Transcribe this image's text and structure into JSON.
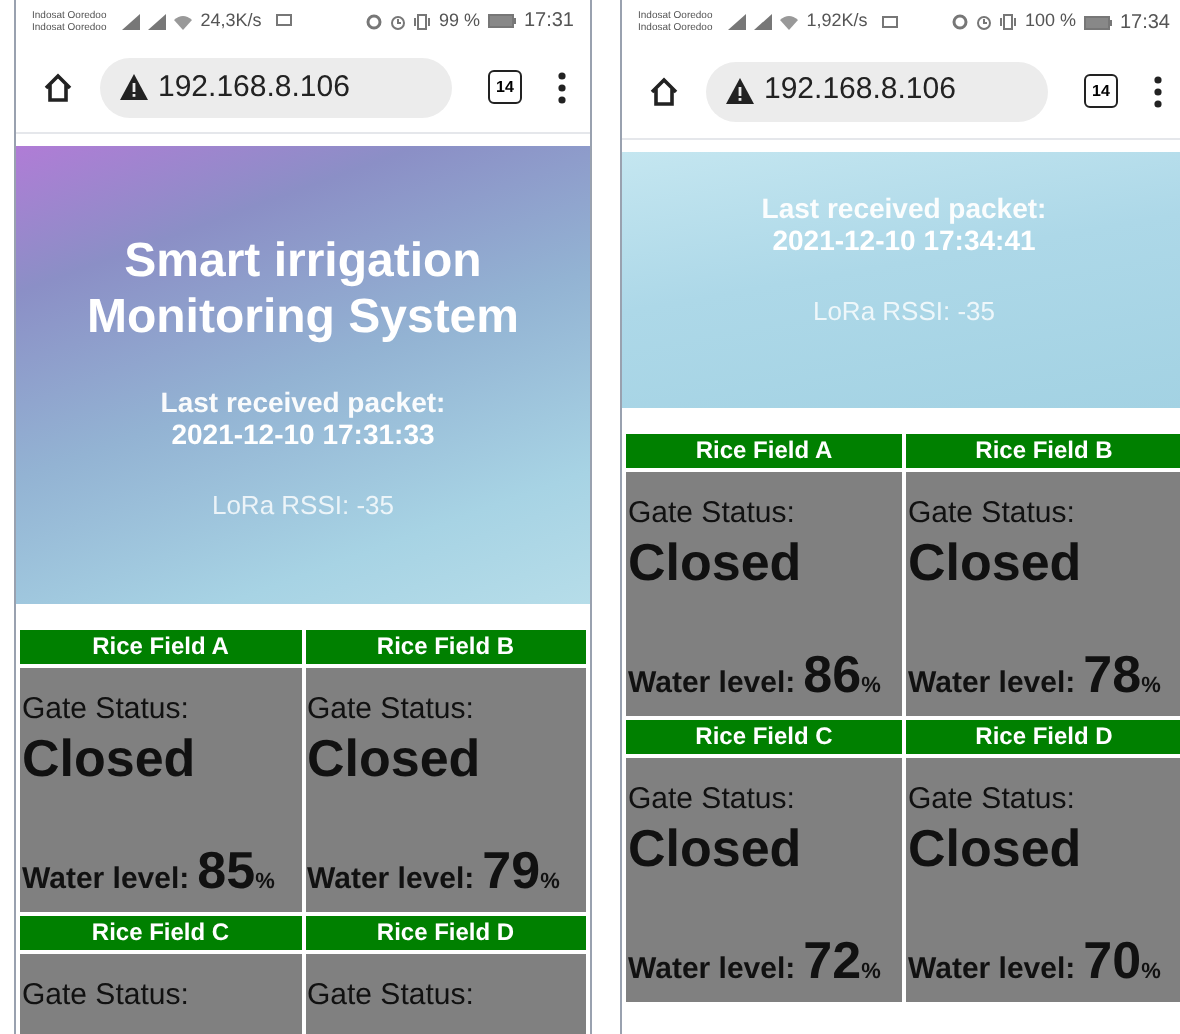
{
  "screens": [
    {
      "status_bar": {
        "carriers": [
          "Indosat Ooredoo",
          "Indosat Ooredoo"
        ],
        "speed": "24,3K/s",
        "battery": "99 %",
        "time": "17:31"
      },
      "browser": {
        "url": "192.168.8.106",
        "tab_count": "14"
      },
      "page": {
        "title": "Smart irrigation Monitoring System",
        "packet_label": "Last received packet:",
        "packet_time": "2021-12-10 17:31:33",
        "rssi": "LoRa RSSI: -35",
        "fields": [
          {
            "name": "Rice Field A",
            "gate_label": "Gate Status:",
            "gate_status": "Closed",
            "water_label": "Water level:",
            "water_value": "85",
            "unit": "%"
          },
          {
            "name": "Rice Field B",
            "gate_label": "Gate Status:",
            "gate_status": "Closed",
            "water_label": "Water level:",
            "water_value": "79",
            "unit": "%"
          },
          {
            "name": "Rice Field C",
            "gate_label": "Gate Status:"
          },
          {
            "name": "Rice Field D",
            "gate_label": "Gate Status:"
          }
        ]
      }
    },
    {
      "status_bar": {
        "carriers": [
          "Indosat Ooredoo",
          "Indosat Ooredoo"
        ],
        "speed": "1,92K/s",
        "battery": "100 %",
        "time": "17:34"
      },
      "browser": {
        "url": "192.168.8.106",
        "tab_count": "14"
      },
      "page": {
        "packet_label": "Last received packet:",
        "packet_time": "2021-12-10 17:34:41",
        "rssi": "LoRa RSSI: -35",
        "fields": [
          {
            "name": "Rice Field A",
            "gate_label": "Gate Status:",
            "gate_status": "Closed",
            "water_label": "Water level:",
            "water_value": "86",
            "unit": "%"
          },
          {
            "name": "Rice Field B",
            "gate_label": "Gate Status:",
            "gate_status": "Closed",
            "water_label": "Water level:",
            "water_value": "78",
            "unit": "%"
          },
          {
            "name": "Rice Field C",
            "gate_label": "Gate Status:",
            "gate_status": "Closed",
            "water_label": "Water level:",
            "water_value": "72",
            "unit": "%"
          },
          {
            "name": "Rice Field D",
            "gate_label": "Gate Status:",
            "gate_status": "Closed",
            "water_label": "Water level:",
            "water_value": "70",
            "unit": "%"
          }
        ]
      }
    }
  ]
}
